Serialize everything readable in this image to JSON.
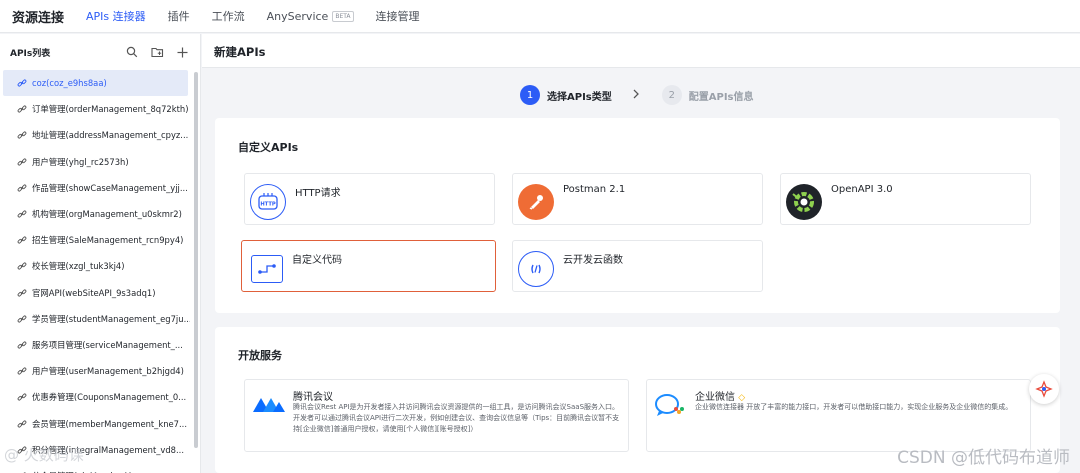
{
  "topbar": {
    "brand": "资源连接",
    "nav": [
      {
        "label": "APIs 连接器",
        "active": true
      },
      {
        "label": "插件"
      },
      {
        "label": "工作流"
      },
      {
        "label": "AnyService",
        "badge": "BETA"
      },
      {
        "label": "连接管理"
      }
    ]
  },
  "sidebar": {
    "title": "APIs列表",
    "items": [
      {
        "label": "coz(coz_e9hs8aa)",
        "selected": true
      },
      {
        "label": "订单管理(orderManagement_8q72kth)"
      },
      {
        "label": "地址管理(addressManagement_cpyz..."
      },
      {
        "label": "用户管理(yhgl_rc2573h)"
      },
      {
        "label": "作品管理(showCaseManagement_yjj..."
      },
      {
        "label": "机构管理(orgManagement_u0skmr2)"
      },
      {
        "label": "招生管理(SaleManagement_rcn9py4)"
      },
      {
        "label": "校长管理(xzgl_tuk3kj4)"
      },
      {
        "label": "官网API(webSiteAPI_9s3adq1)"
      },
      {
        "label": "学员管理(studentManagement_eg7ju..."
      },
      {
        "label": "服务项目管理(serviceManagement_..."
      },
      {
        "label": "用户管理(userManagement_b2hjgd4)"
      },
      {
        "label": "优惠券管理(CouponsManagement_0..."
      },
      {
        "label": "会员管理(memberMangement_kne7..."
      },
      {
        "label": "积分管理(integralManagement_vd8..."
      },
      {
        "label": "分会员管理(vipMemberManage..."
      }
    ]
  },
  "main": {
    "title": "新建APIs",
    "steps": [
      {
        "num": "1",
        "label": "选择APIs类型",
        "active": true
      },
      {
        "num": "2",
        "label": "配置APIs信息",
        "active": false
      }
    ],
    "custom": {
      "title": "自定义APIs",
      "tiles": [
        {
          "label": "HTTP请求",
          "icon": "http-icon"
        },
        {
          "label": "Postman 2.1",
          "icon": "postman-icon"
        },
        {
          "label": "OpenAPI 3.0",
          "icon": "openapi-icon"
        },
        {
          "label": "自定义代码",
          "icon": "code-icon",
          "selected": true
        },
        {
          "label": "云开发云函数",
          "icon": "cloud-function-icon"
        }
      ]
    },
    "open": {
      "title": "开放服务",
      "services": [
        {
          "name": "腾讯会议",
          "icon": "tencent-meeting-icon",
          "desc": "腾讯会议Rest API是为开发者接入并访问腾讯会议资源提供的一组工具，是访问腾讯会议SaaS服务入口。开发者可以通过腾讯会议API进行二次开发，例如创建会议、查询会议信息等（Tips：目前腾讯会议暂不支持[企业微信]普通用户授权，请使用[个人微信][账号授权]）"
        },
        {
          "name": "企业微信",
          "icon": "wecom-icon",
          "desc": "企业微信连接器 开放了丰富的能力接口，开发者可以借助接口能力，实现企业服务及企业微信的集成。"
        }
      ]
    }
  },
  "watermark": "CSDN @低代码布道师",
  "watermark_left": "@ 火数码课",
  "colors": {
    "accent": "#2c5cf6",
    "selected_border": "#e0603a"
  }
}
